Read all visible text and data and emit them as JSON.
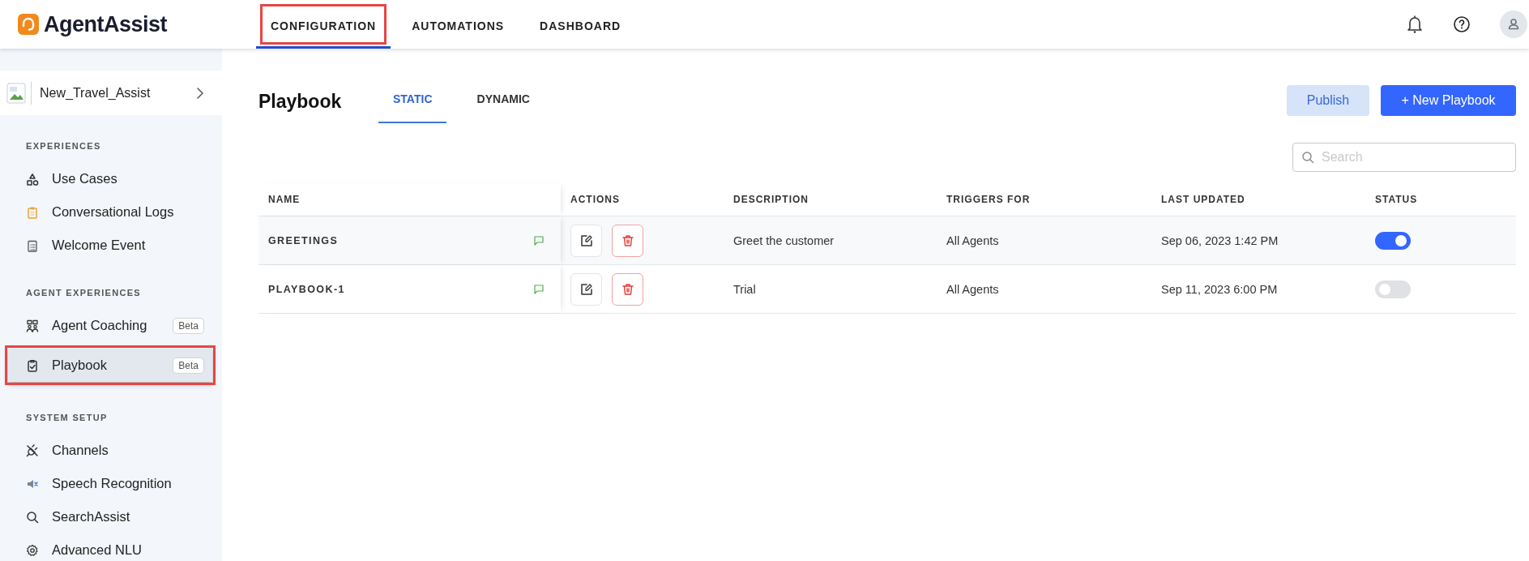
{
  "app": {
    "name": "AgentAssist"
  },
  "nav_tabs": [
    {
      "label": "CONFIGURATION",
      "selected": true,
      "highlighted": true
    },
    {
      "label": "AUTOMATIONS",
      "selected": false,
      "highlighted": false
    },
    {
      "label": "DASHBOARD",
      "selected": false,
      "highlighted": false
    }
  ],
  "project": {
    "name": "New_Travel_Assist"
  },
  "sidebar": {
    "sections": [
      {
        "title": "EXPERIENCES",
        "items": [
          {
            "label": "Use Cases",
            "selected": false,
            "highlighted": false
          },
          {
            "label": "Conversational Logs",
            "selected": false,
            "highlighted": false
          },
          {
            "label": "Welcome Event",
            "selected": false,
            "highlighted": false
          }
        ]
      },
      {
        "title": "AGENT EXPERIENCES",
        "items": [
          {
            "label": "Agent Coaching",
            "badge": "Beta",
            "selected": false,
            "highlighted": false
          },
          {
            "label": "Playbook",
            "badge": "Beta",
            "selected": true,
            "highlighted": true
          }
        ]
      },
      {
        "title": "SYSTEM SETUP",
        "items": [
          {
            "label": "Channels",
            "selected": false,
            "highlighted": false
          },
          {
            "label": "Speech Recognition",
            "selected": false,
            "highlighted": false
          },
          {
            "label": "SearchAssist",
            "selected": false,
            "highlighted": false
          },
          {
            "label": "Advanced NLU",
            "selected": false,
            "highlighted": false
          }
        ]
      }
    ]
  },
  "page": {
    "title": "Playbook",
    "tabs": [
      {
        "label": "STATIC",
        "selected": true
      },
      {
        "label": "DYNAMIC",
        "selected": false
      }
    ],
    "buttons": [
      {
        "label": "Publish",
        "kind": "secondary"
      },
      {
        "label": "+ New Playbook",
        "kind": "primary"
      }
    ],
    "search": {
      "placeholder": "Search"
    }
  },
  "table": {
    "columns": [
      "NAME",
      "ACTIONS",
      "DESCRIPTION",
      "TRIGGERS FOR",
      "LAST UPDATED",
      "STATUS"
    ],
    "rows": [
      {
        "name": "GREETINGS",
        "description": "Greet the customer",
        "triggers_for": "All Agents",
        "last_updated": "Sep 06, 2023 1:42 PM",
        "on": true
      },
      {
        "name": "PLAYBOOK-1",
        "description": "Trial",
        "triggers_for": "All Agents",
        "last_updated": "Sep 11, 2023 6:00 PM",
        "on": false
      }
    ]
  }
}
